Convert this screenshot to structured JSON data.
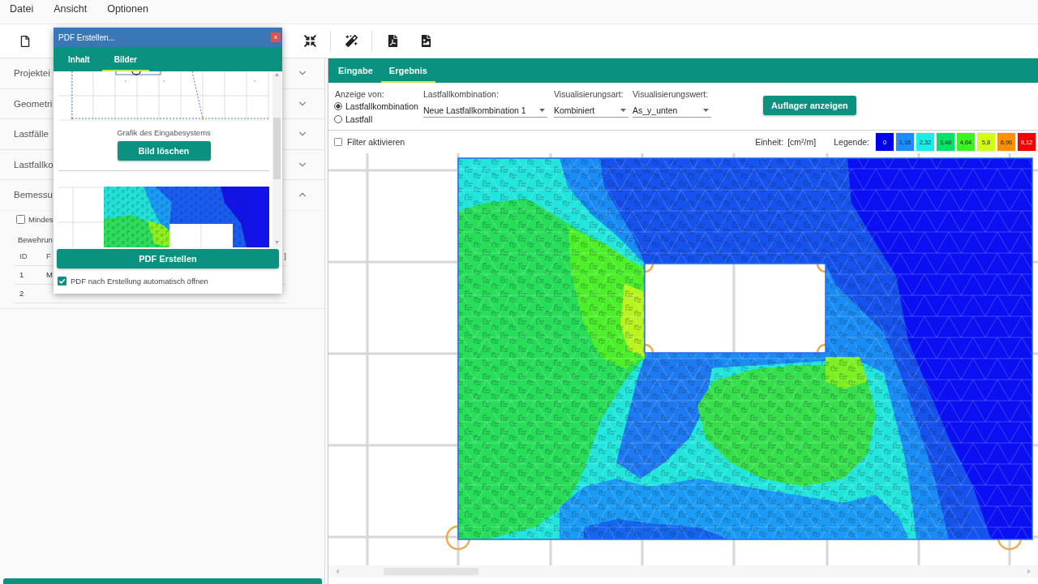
{
  "menu_bar": {
    "items": [
      "Datei",
      "Ansicht",
      "Optionen"
    ]
  },
  "sidebar": {
    "sections": [
      {
        "title": "Projektei",
        "expanded": false
      },
      {
        "title": "Geometri",
        "expanded": false
      },
      {
        "title": "Lastfälle",
        "expanded": false
      },
      {
        "title": "Lastfallko",
        "expanded": false
      },
      {
        "title": "Bemessu",
        "expanded": true,
        "content": {
          "checkbox": {
            "label": "Mindes",
            "checked": false
          },
          "subtitle": "Bewehrun",
          "table": {
            "columns": [
              "ID",
              "F",
              "]"
            ],
            "rows": [
              [
                "1",
                "M"
              ],
              [
                "2"
              ]
            ]
          }
        }
      }
    ]
  },
  "result_panel": {
    "tabs": [
      {
        "label": "Eingabe",
        "selected": false
      },
      {
        "label": "Ergebnis",
        "selected": true
      }
    ],
    "display_of": {
      "label": "Anzeige von:",
      "options": [
        {
          "label": "Lastfallkombination",
          "selected": true
        },
        {
          "label": "Lastfall",
          "selected": false
        }
      ]
    },
    "selects": [
      {
        "label": "Lastfallkombination:",
        "value": "Neue Lastfallkombination 1"
      },
      {
        "label": "Visualisierungsart:",
        "value": "Kombiniert"
      },
      {
        "label": "Visualisierungswert:",
        "value": "As_y_unten"
      }
    ],
    "supports_button": "Auflager anzeigen",
    "filter": {
      "label": "Filter aktivieren",
      "checked": false
    },
    "unit": {
      "label": "Einheit:",
      "value": "[cm²/m]"
    },
    "legend": {
      "label": "Legende:",
      "items": [
        {
          "label": "0",
          "color": "#0000f0"
        },
        {
          "label": "1,16",
          "color": "#1e8cff"
        },
        {
          "label": "2,32",
          "color": "#14f0e6"
        },
        {
          "label": "3,48",
          "color": "#00e36a"
        },
        {
          "label": "4,64",
          "color": "#3cf51e"
        },
        {
          "label": "5,8",
          "color": "#d2ff14"
        },
        {
          "label": "6,96",
          "color": "#ff9100"
        },
        {
          "label": "8,12",
          "color": "#f50000"
        }
      ]
    }
  },
  "dialog": {
    "title": "PDF Erstellen...",
    "close": "x",
    "tabs": [
      {
        "label": "Inhalt",
        "selected": false
      },
      {
        "label": "Bilder",
        "selected": true
      }
    ],
    "images": [
      {
        "kind": "system",
        "caption": "Grafik des Eingabesystems",
        "delete_button": "Bild löschen"
      },
      {
        "kind": "contour"
      }
    ],
    "create_button": "PDF Erstellen",
    "auto_open": {
      "label": "PDF nach Erstellung automatisch öffnen",
      "checked": true
    }
  }
}
